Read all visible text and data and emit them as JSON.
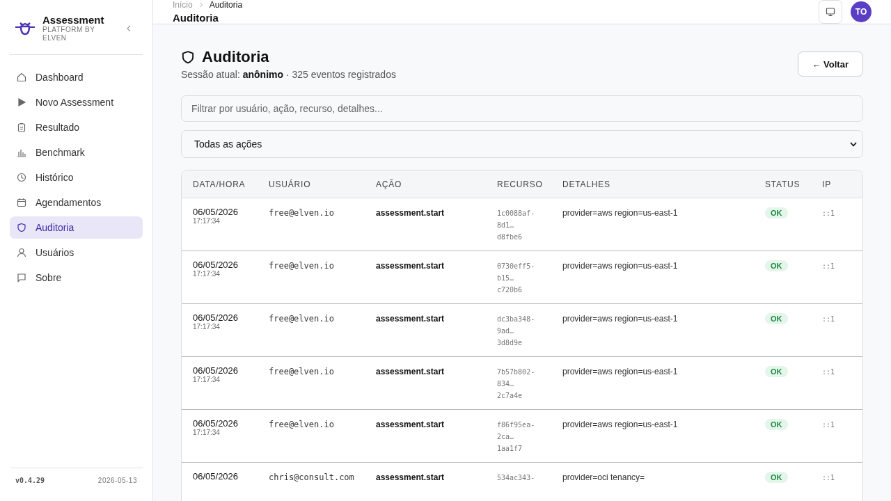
{
  "brand": {
    "name": "Assessment",
    "subtitle": "PLATFORM BY ELVEN"
  },
  "nav": [
    {
      "label": "Dashboard",
      "selected": false
    },
    {
      "label": "Novo Assessment",
      "selected": false
    },
    {
      "label": "Resultado",
      "selected": false
    },
    {
      "label": "Benchmark",
      "selected": false
    },
    {
      "label": "Histórico",
      "selected": false
    },
    {
      "label": "Agendamentos",
      "selected": false
    },
    {
      "label": "Auditoria",
      "selected": true
    },
    {
      "label": "Usuários",
      "selected": false
    },
    {
      "label": "Sobre",
      "selected": false
    }
  ],
  "footer": {
    "version": "v0.4.29",
    "date": "2026-05-13"
  },
  "breadcrumb": [
    "Início",
    "Auditoria"
  ],
  "header_title": "Auditoria",
  "avatar": "TO",
  "page": {
    "title": "Auditoria",
    "session_label": "Sessão atual:",
    "session_user": "anônimo",
    "session_rest": "· 325 eventos registrados",
    "back": "← Voltar"
  },
  "filter": {
    "placeholder": "Filtrar por usuário, ação, recurso, detalhes..."
  },
  "action_select": {
    "value": "Todas as ações"
  },
  "table": {
    "columns": [
      "DATA/HORA",
      "USUÁRIO",
      "AÇÃO",
      "RECURSO",
      "DETALHES",
      "STATUS",
      "IP"
    ],
    "rows": [
      {
        "date": "06/05/2026",
        "time": "17:17:34",
        "user": "free@elven.io",
        "action": "assessment.start",
        "resource": [
          "1c0088af-",
          "8d1…",
          "d8fbe6"
        ],
        "details": "provider=aws region=us-east-1",
        "status": "OK",
        "ip": "::1"
      },
      {
        "date": "06/05/2026",
        "time": "17:17:34",
        "user": "free@elven.io",
        "action": "assessment.start",
        "resource": [
          "0730eff5-",
          "b15…",
          "c720b6"
        ],
        "details": "provider=aws region=us-east-1",
        "status": "OK",
        "ip": "::1"
      },
      {
        "date": "06/05/2026",
        "time": "17:17:34",
        "user": "free@elven.io",
        "action": "assessment.start",
        "resource": [
          "dc3ba348-",
          "9ad…",
          "3d8d9e"
        ],
        "details": "provider=aws region=us-east-1",
        "status": "OK",
        "ip": "::1"
      },
      {
        "date": "06/05/2026",
        "time": "17:17:34",
        "user": "free@elven.io",
        "action": "assessment.start",
        "resource": [
          "7b57b802-",
          "834…",
          "2c7a4e"
        ],
        "details": "provider=aws region=us-east-1",
        "status": "OK",
        "ip": "::1"
      },
      {
        "date": "06/05/2026",
        "time": "17:17:34",
        "user": "free@elven.io",
        "action": "assessment.start",
        "resource": [
          "f86f95ea-",
          "2ca…",
          "1aa1f7"
        ],
        "details": "provider=aws region=us-east-1",
        "status": "OK",
        "ip": "::1"
      },
      {
        "date": "06/05/2026",
        "user": "chris@consult.com",
        "action": "assessment.start",
        "resource": [
          "534ac343-"
        ],
        "details": "provider=oci tenancy=",
        "status": "OK",
        "ip": "::1"
      }
    ]
  }
}
